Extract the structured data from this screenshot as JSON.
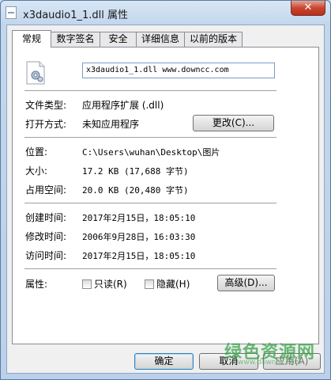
{
  "window": {
    "title": "x3daudio1_1.dll 属性",
    "close_glyph": "✕"
  },
  "tabs": [
    {
      "label": "常规",
      "active": true
    },
    {
      "label": "数字签名"
    },
    {
      "label": "安全"
    },
    {
      "label": "详细信息"
    },
    {
      "label": "以前的版本"
    }
  ],
  "general": {
    "file_name": "x3daudio1_1.dll www.downcc.com",
    "file_type_label": "文件类型:",
    "file_type_value": "应用程序扩展 (.dll)",
    "opens_with_label": "打开方式:",
    "opens_with_value": "未知应用程序",
    "change_button": "更改(C)...",
    "location_label": "位置:",
    "location_value": "C:\\Users\\wuhan\\Desktop\\图片",
    "size_label": "大小:",
    "size_value": "17.2 KB (17,688 字节)",
    "disk_size_label": "占用空间:",
    "disk_size_value": "20.0 KB (20,480 字节)",
    "created_label": "创建时间:",
    "created_value": "2017年2月15日，18:05:10",
    "modified_label": "修改时间:",
    "modified_value": "2006年9月28日，16:03:30",
    "accessed_label": "访问时间:",
    "accessed_value": "2017年2月15日，18:05:10",
    "attributes_label": "属性:",
    "readonly_label": "只读(R)",
    "hidden_label": "隐藏(H)",
    "advanced_button": "高级(D)..."
  },
  "footer": {
    "ok_button": "确定",
    "cancel_button": "取消",
    "apply_button": "应用(A)"
  },
  "watermark": {
    "text": "绿色资源网",
    "sub": "www.downcc.com"
  }
}
